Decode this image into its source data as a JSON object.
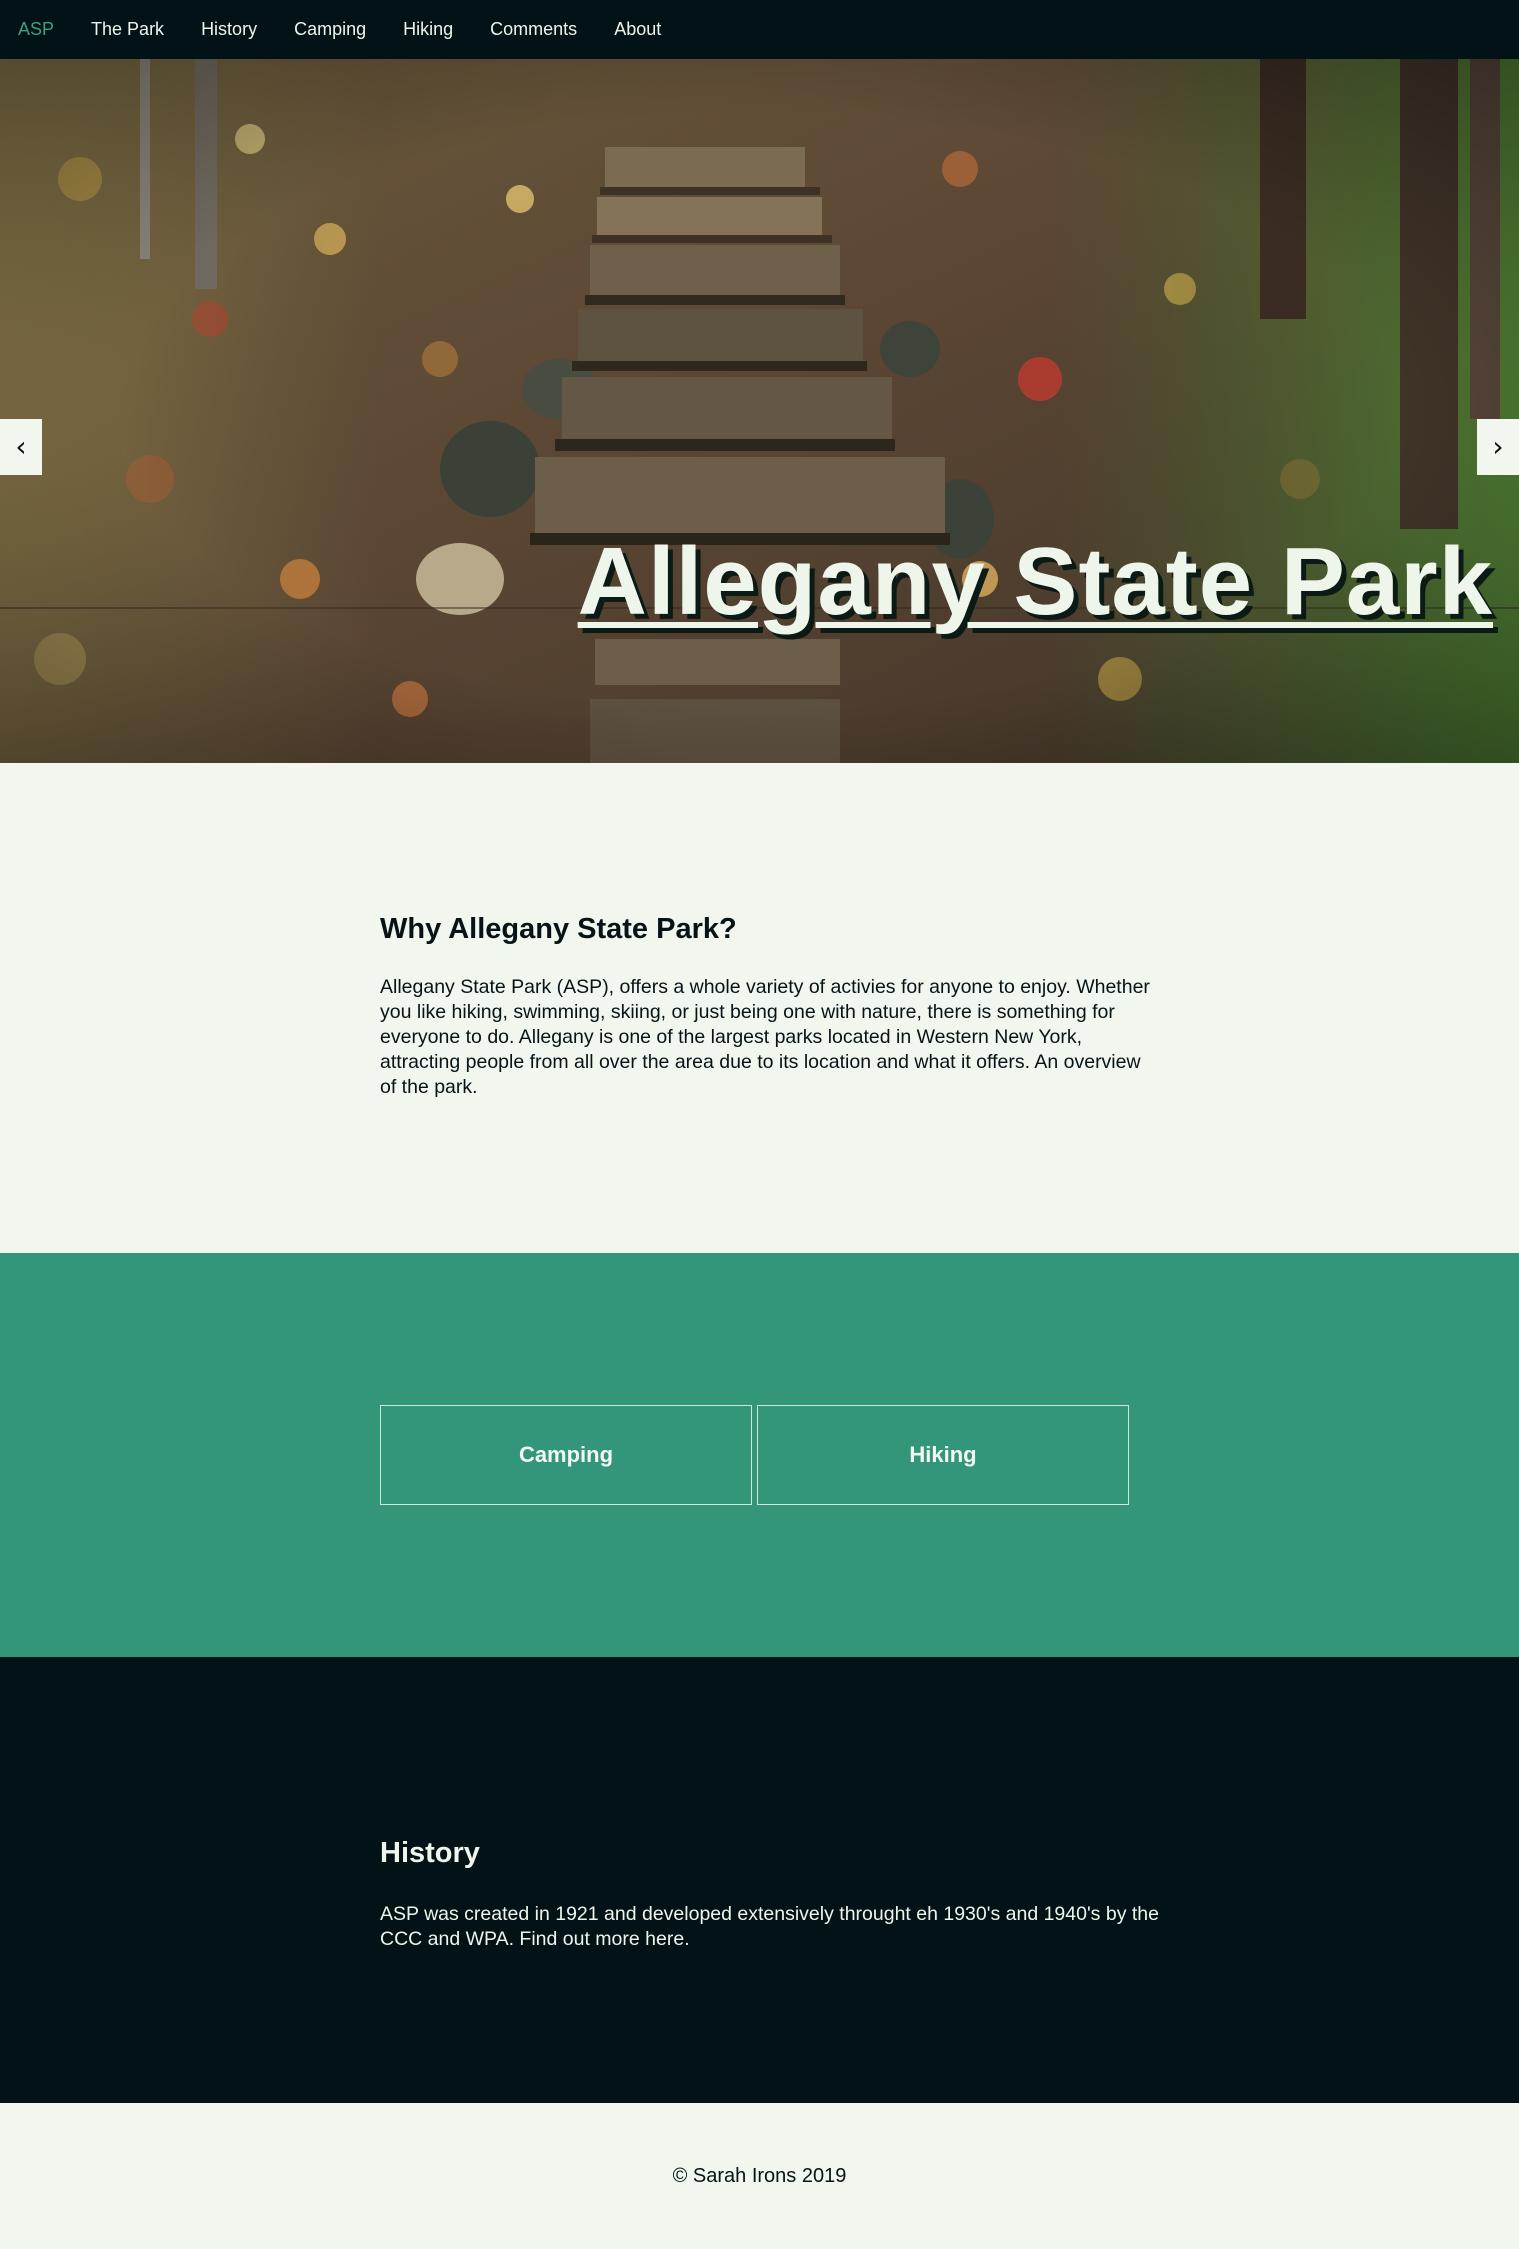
{
  "nav": {
    "brand": "ASP",
    "items": [
      "The Park",
      "History",
      "Camping",
      "Hiking",
      "Comments",
      "About"
    ]
  },
  "hero": {
    "title": "Allegany State Park",
    "prev_arrow": "‹",
    "next_arrow": "›"
  },
  "intro": {
    "heading": "Why Allegany State Park?",
    "body": "Allegany State Park (ASP), offers a whole variety of activies for anyone to enjoy. Whether you like hiking, swimming, skiing, or just being one with nature, there is something for everyone to do. Allegany is one of the largest parks located in Western New York, attracting people from all over the area due to its location and what it offers. An overview of the park."
  },
  "activities": {
    "tiles": [
      "Camping",
      "Hiking"
    ]
  },
  "history": {
    "heading": "History",
    "body": "ASP was created in 1921 and developed extensively throught eh 1930's and 1940's by the CCC and WPA. Find out more ",
    "link": "here",
    "tail": "."
  },
  "footer": {
    "copyright": "© Sarah Irons 2019"
  },
  "colors": {
    "nav_bg": "#021217",
    "brand_accent": "#3da17f",
    "activities_bg": "#33957a",
    "page_bg": "#f1f6ee"
  }
}
